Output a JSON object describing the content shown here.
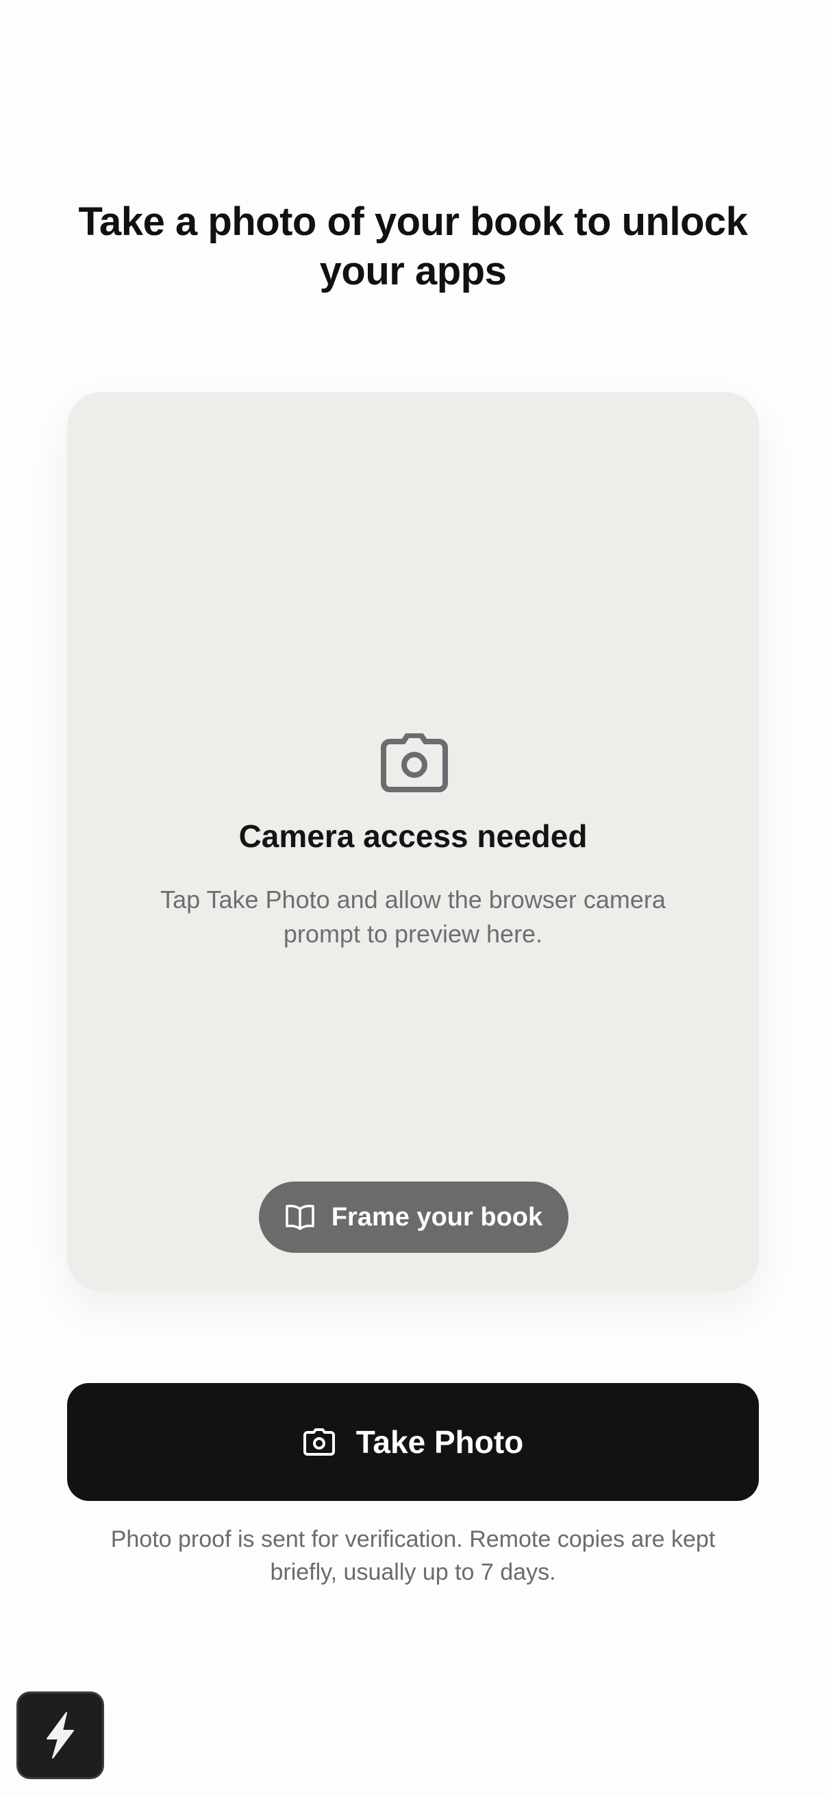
{
  "header": {
    "title": "Take a photo of your book to unlock your apps"
  },
  "preview": {
    "icon": "camera-icon",
    "heading": "Camera access needed",
    "hint": "Tap Take Photo and allow the browser camera prompt to preview here.",
    "frame_badge": {
      "icon": "book-open-icon",
      "label": "Frame your book"
    }
  },
  "actions": {
    "take_photo": {
      "icon": "camera-icon",
      "label": "Take Photo"
    }
  },
  "footnote": "Photo proof is sent for verification. Remote copies are kept briefly, usually up to 7 days.",
  "quick_action": {
    "icon": "lightning-bolt-icon"
  },
  "colors": {
    "background": "#fdfdfd",
    "preview_surface": "#ededea",
    "primary_button": "#121212",
    "badge": "#6b6b6b",
    "muted_text": "#6e6e72"
  }
}
